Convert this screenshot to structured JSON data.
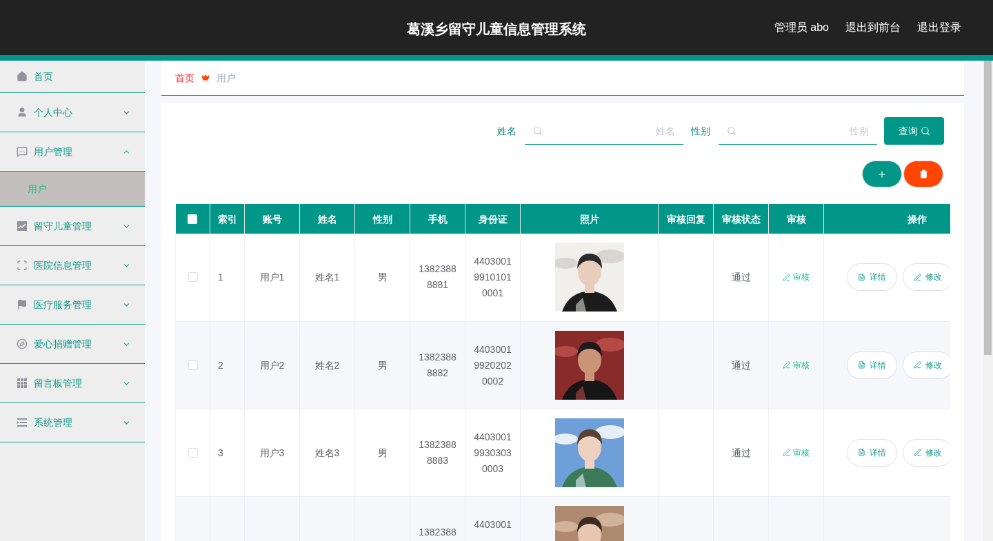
{
  "header": {
    "title": "葛溪乡留守儿童信息管理系统",
    "links": [
      "管理员 abo",
      "退出到前台",
      "退出登录"
    ]
  },
  "sidebar": {
    "items": [
      {
        "label": "首页",
        "kind": "link"
      },
      {
        "label": "个人中心",
        "kind": "menu",
        "expanded": false
      },
      {
        "label": "用户管理",
        "kind": "menu",
        "expanded": true,
        "children": [
          {
            "label": "用户",
            "selected": true
          }
        ]
      },
      {
        "label": "留守儿童管理",
        "kind": "menu",
        "expanded": false
      },
      {
        "label": "医院信息管理",
        "kind": "menu",
        "expanded": false
      },
      {
        "label": "医疗服务管理",
        "kind": "menu",
        "expanded": false
      },
      {
        "label": "爱心捐赠管理",
        "kind": "menu",
        "expanded": false
      },
      {
        "label": "留言板管理",
        "kind": "menu",
        "expanded": false
      },
      {
        "label": "系统管理",
        "kind": "menu",
        "expanded": false
      }
    ]
  },
  "breadcrumb": [
    "首页",
    "用户"
  ],
  "search": {
    "fields": [
      {
        "label": "姓名",
        "placeholder": "姓名"
      },
      {
        "label": "性别",
        "placeholder": "性别"
      }
    ],
    "button": "查询"
  },
  "table": {
    "select_all": {
      "checked": false
    },
    "columns": [
      "索引",
      "账号",
      "姓名",
      "性别",
      "手机",
      "身份证",
      "照片",
      "审核回复",
      "审核状态",
      "审核",
      "操作"
    ],
    "rows": [
      {
        "checked": false,
        "index": "1",
        "account": "用户1",
        "name": "姓名1",
        "gender": "男",
        "phone": "13823888881",
        "id_card": "440300199101010001",
        "photo": {
          "kind": "picture"
        },
        "review_status": "通过",
        "review_action": "审核",
        "actions": [
          "详情",
          "修改"
        ]
      },
      {
        "checked": false,
        "index": "2",
        "account": "用户2",
        "name": "姓名2",
        "gender": "男",
        "phone": "13823888882",
        "id_card": "440300199202020002",
        "photo": {
          "kind": "picture"
        },
        "review_status": "通过",
        "review_action": "审核",
        "actions": [
          "详情",
          "修改"
        ]
      },
      {
        "checked": false,
        "index": "3",
        "account": "用户3",
        "name": "姓名3",
        "gender": "男",
        "phone": "13823888883",
        "id_card": "440300199303030003",
        "photo": {
          "kind": "picture"
        },
        "review_status": "通过",
        "review_action": "审核",
        "actions": [
          "详情",
          "修改"
        ]
      },
      {
        "phone": "1382388",
        "id_card": "4403001",
        "photo": {
          "kind": "picture"
        }
      }
    ]
  }
}
